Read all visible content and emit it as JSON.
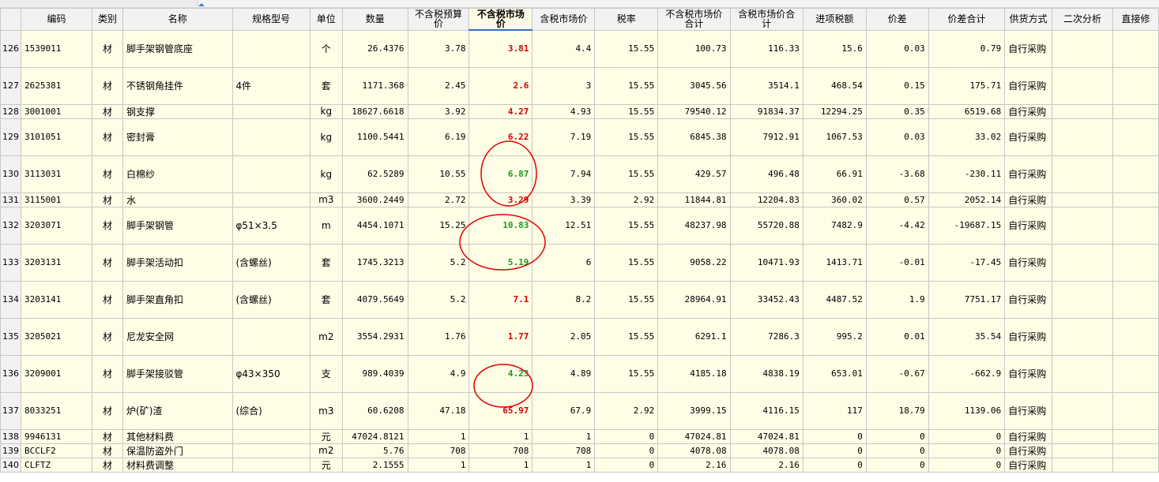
{
  "colors": {
    "row_bg": "#fefde6",
    "header_bg": "#f2f2f2",
    "grid_line": "#c8c8c8",
    "price_red": "#d40000",
    "price_green": "#1a9a1a",
    "circle_red": "#e00000",
    "header_underline": "#2f6fcf"
  },
  "columns": [
    {
      "key": "code",
      "label": "编码"
    },
    {
      "key": "cat",
      "label": "类别"
    },
    {
      "key": "name",
      "label": "名称"
    },
    {
      "key": "spec",
      "label": "规格型号"
    },
    {
      "key": "unit",
      "label": "单位"
    },
    {
      "key": "qty",
      "label": "数量"
    },
    {
      "key": "budget",
      "label": "不含税预算价"
    },
    {
      "key": "market",
      "label": "不含税市场价"
    },
    {
      "key": "market_tax",
      "label": "含税市场价"
    },
    {
      "key": "tax_rate",
      "label": "税率"
    },
    {
      "key": "market_total",
      "label": "不含税市场价合计"
    },
    {
      "key": "market_tax_total",
      "label": "含税市场价合计"
    },
    {
      "key": "input_tax",
      "label": "进项税额"
    },
    {
      "key": "diff",
      "label": "价差"
    },
    {
      "key": "diff_total",
      "label": "价差合计"
    },
    {
      "key": "supply",
      "label": "供货方式"
    },
    {
      "key": "analysis",
      "label": "二次分析"
    },
    {
      "key": "direct",
      "label": "直接修"
    }
  ],
  "rows": [
    {
      "n": "126",
      "code": "1539011",
      "cat": "材",
      "name": "脚手架钢管底座",
      "spec": "",
      "unit": "个",
      "qty": "26.4376",
      "budget": "3.78",
      "market": "3.81",
      "market_color": "red",
      "market_tax": "4.4",
      "tax_rate": "15.55",
      "market_total": "100.73",
      "market_tax_total": "116.33",
      "input_tax": "15.6",
      "diff": "0.03",
      "diff_total": "0.79",
      "supply": "自行采购",
      "analysis": "",
      "direct": ""
    },
    {
      "n": "127",
      "code": "2625381",
      "cat": "材",
      "name": "不锈钢角挂件",
      "spec": "4件",
      "unit": "套",
      "qty": "1171.368",
      "budget": "2.45",
      "market": "2.6",
      "market_color": "red",
      "market_tax": "3",
      "tax_rate": "15.55",
      "market_total": "3045.56",
      "market_tax_total": "3514.1",
      "input_tax": "468.54",
      "diff": "0.15",
      "diff_total": "175.71",
      "supply": "自行采购",
      "analysis": "",
      "direct": ""
    },
    {
      "n": "128",
      "code": "3001001",
      "cat": "材",
      "name": "钢支撑",
      "spec": "",
      "unit": "kg",
      "qty": "18627.6618",
      "budget": "3.92",
      "market": "4.27",
      "market_color": "red",
      "market_tax": "4.93",
      "tax_rate": "15.55",
      "market_total": "79540.12",
      "market_tax_total": "91834.37",
      "input_tax": "12294.25",
      "diff": "0.35",
      "diff_total": "6519.68",
      "supply": "自行采购",
      "analysis": "",
      "direct": ""
    },
    {
      "n": "129",
      "code": "3101051",
      "cat": "材",
      "name": "密封膏",
      "spec": "",
      "unit": "kg",
      "qty": "1100.5441",
      "budget": "6.19",
      "market": "6.22",
      "market_color": "red",
      "market_tax": "7.19",
      "tax_rate": "15.55",
      "market_total": "6845.38",
      "market_tax_total": "7912.91",
      "input_tax": "1067.53",
      "diff": "0.03",
      "diff_total": "33.02",
      "supply": "自行采购",
      "analysis": "",
      "direct": ""
    },
    {
      "n": "130",
      "code": "3113031",
      "cat": "材",
      "name": "白棉纱",
      "spec": "",
      "unit": "kg",
      "qty": "62.5289",
      "budget": "10.55",
      "market": "6.87",
      "market_color": "green",
      "market_tax": "7.94",
      "tax_rate": "15.55",
      "market_total": "429.57",
      "market_tax_total": "496.48",
      "input_tax": "66.91",
      "diff": "-3.68",
      "diff_total": "-230.11",
      "supply": "自行采购",
      "analysis": "",
      "direct": ""
    },
    {
      "n": "131",
      "code": "3115001",
      "cat": "材",
      "name": "水",
      "spec": "",
      "unit": "m3",
      "qty": "3600.2449",
      "budget": "2.72",
      "market": "3.29",
      "market_color": "red",
      "market_tax": "3.39",
      "tax_rate": "2.92",
      "market_total": "11844.81",
      "market_tax_total": "12204.83",
      "input_tax": "360.02",
      "diff": "0.57",
      "diff_total": "2052.14",
      "supply": "自行采购",
      "analysis": "",
      "direct": ""
    },
    {
      "n": "132",
      "code": "3203071",
      "cat": "材",
      "name": "脚手架钢管",
      "spec": "φ51×3.5",
      "unit": "m",
      "qty": "4454.1071",
      "budget": "15.25",
      "market": "10.83",
      "market_color": "green",
      "market_tax": "12.51",
      "tax_rate": "15.55",
      "market_total": "48237.98",
      "market_tax_total": "55720.88",
      "input_tax": "7482.9",
      "diff": "-4.42",
      "diff_total": "-19687.15",
      "supply": "自行采购",
      "analysis": "",
      "direct": ""
    },
    {
      "n": "133",
      "code": "3203131",
      "cat": "材",
      "name": "脚手架活动扣",
      "spec": "(含螺丝)",
      "unit": "套",
      "qty": "1745.3213",
      "budget": "5.2",
      "market": "5.19",
      "market_color": "green",
      "market_tax": "6",
      "tax_rate": "15.55",
      "market_total": "9058.22",
      "market_tax_total": "10471.93",
      "input_tax": "1413.71",
      "diff": "-0.01",
      "diff_total": "-17.45",
      "supply": "自行采购",
      "analysis": "",
      "direct": ""
    },
    {
      "n": "134",
      "code": "3203141",
      "cat": "材",
      "name": "脚手架直角扣",
      "spec": "(含螺丝)",
      "unit": "套",
      "qty": "4079.5649",
      "budget": "5.2",
      "market": "7.1",
      "market_color": "red",
      "market_tax": "8.2",
      "tax_rate": "15.55",
      "market_total": "28964.91",
      "market_tax_total": "33452.43",
      "input_tax": "4487.52",
      "diff": "1.9",
      "diff_total": "7751.17",
      "supply": "自行采购",
      "analysis": "",
      "direct": ""
    },
    {
      "n": "135",
      "code": "3205021",
      "cat": "材",
      "name": "尼龙安全网",
      "spec": "",
      "unit": "m2",
      "qty": "3554.2931",
      "budget": "1.76",
      "market": "1.77",
      "market_color": "red",
      "market_tax": "2.05",
      "tax_rate": "15.55",
      "market_total": "6291.1",
      "market_tax_total": "7286.3",
      "input_tax": "995.2",
      "diff": "0.01",
      "diff_total": "35.54",
      "supply": "自行采购",
      "analysis": "",
      "direct": ""
    },
    {
      "n": "136",
      "code": "3209001",
      "cat": "材",
      "name": "脚手架接驳管",
      "spec": "φ43×350",
      "unit": "支",
      "qty": "989.4039",
      "budget": "4.9",
      "market": "4.23",
      "market_color": "green",
      "market_tax": "4.89",
      "tax_rate": "15.55",
      "market_total": "4185.18",
      "market_tax_total": "4838.19",
      "input_tax": "653.01",
      "diff": "-0.67",
      "diff_total": "-662.9",
      "supply": "自行采购",
      "analysis": "",
      "direct": ""
    },
    {
      "n": "137",
      "code": "8033251",
      "cat": "材",
      "name": "炉(矿)渣",
      "spec": "(综合)",
      "unit": "m3",
      "qty": "60.6208",
      "budget": "47.18",
      "market": "65.97",
      "market_color": "red",
      "market_tax": "67.9",
      "tax_rate": "2.92",
      "market_total": "3999.15",
      "market_tax_total": "4116.15",
      "input_tax": "117",
      "diff": "18.79",
      "diff_total": "1139.06",
      "supply": "自行采购",
      "analysis": "",
      "direct": ""
    },
    {
      "n": "138",
      "code": "9946131",
      "cat": "材",
      "name": "其他材料费",
      "spec": "",
      "unit": "元",
      "qty": "47024.8121",
      "budget": "1",
      "market": "1",
      "market_color": "black",
      "market_tax": "1",
      "tax_rate": "0",
      "market_total": "47024.81",
      "market_tax_total": "47024.81",
      "input_tax": "0",
      "diff": "0",
      "diff_total": "0",
      "supply": "自行采购",
      "analysis": "",
      "direct": ""
    },
    {
      "n": "139",
      "code": "BCCLF2",
      "cat": "材",
      "name": "保温防盗外门",
      "spec": "",
      "unit": "m2",
      "qty": "5.76",
      "budget": "708",
      "market": "708",
      "market_color": "black",
      "market_tax": "708",
      "tax_rate": "0",
      "market_total": "4078.08",
      "market_tax_total": "4078.08",
      "input_tax": "0",
      "diff": "0",
      "diff_total": "0",
      "supply": "自行采购",
      "analysis": "",
      "direct": ""
    },
    {
      "n": "140",
      "code": "CLFTZ",
      "cat": "材",
      "name": "材料费调整",
      "spec": "",
      "unit": "元",
      "qty": "2.1555",
      "budget": "1",
      "market": "1",
      "market_color": "black",
      "market_tax": "1",
      "tax_rate": "0",
      "market_total": "2.16",
      "market_tax_total": "2.16",
      "input_tax": "0",
      "diff": "0",
      "diff_total": "0",
      "supply": "自行采购",
      "analysis": "",
      "direct": ""
    }
  ]
}
